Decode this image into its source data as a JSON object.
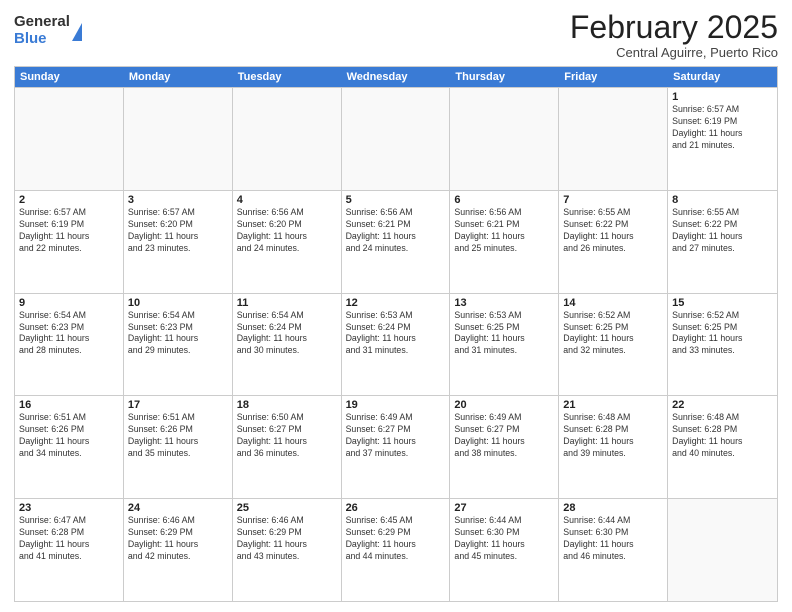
{
  "logo": {
    "general": "General",
    "blue": "Blue"
  },
  "title": "February 2025",
  "location": "Central Aguirre, Puerto Rico",
  "header_days": [
    "Sunday",
    "Monday",
    "Tuesday",
    "Wednesday",
    "Thursday",
    "Friday",
    "Saturday"
  ],
  "rows": [
    [
      {
        "day": "",
        "info": ""
      },
      {
        "day": "",
        "info": ""
      },
      {
        "day": "",
        "info": ""
      },
      {
        "day": "",
        "info": ""
      },
      {
        "day": "",
        "info": ""
      },
      {
        "day": "",
        "info": ""
      },
      {
        "day": "1",
        "info": "Sunrise: 6:57 AM\nSunset: 6:19 PM\nDaylight: 11 hours\nand 21 minutes."
      }
    ],
    [
      {
        "day": "2",
        "info": "Sunrise: 6:57 AM\nSunset: 6:19 PM\nDaylight: 11 hours\nand 22 minutes."
      },
      {
        "day": "3",
        "info": "Sunrise: 6:57 AM\nSunset: 6:20 PM\nDaylight: 11 hours\nand 23 minutes."
      },
      {
        "day": "4",
        "info": "Sunrise: 6:56 AM\nSunset: 6:20 PM\nDaylight: 11 hours\nand 24 minutes."
      },
      {
        "day": "5",
        "info": "Sunrise: 6:56 AM\nSunset: 6:21 PM\nDaylight: 11 hours\nand 24 minutes."
      },
      {
        "day": "6",
        "info": "Sunrise: 6:56 AM\nSunset: 6:21 PM\nDaylight: 11 hours\nand 25 minutes."
      },
      {
        "day": "7",
        "info": "Sunrise: 6:55 AM\nSunset: 6:22 PM\nDaylight: 11 hours\nand 26 minutes."
      },
      {
        "day": "8",
        "info": "Sunrise: 6:55 AM\nSunset: 6:22 PM\nDaylight: 11 hours\nand 27 minutes."
      }
    ],
    [
      {
        "day": "9",
        "info": "Sunrise: 6:54 AM\nSunset: 6:23 PM\nDaylight: 11 hours\nand 28 minutes."
      },
      {
        "day": "10",
        "info": "Sunrise: 6:54 AM\nSunset: 6:23 PM\nDaylight: 11 hours\nand 29 minutes."
      },
      {
        "day": "11",
        "info": "Sunrise: 6:54 AM\nSunset: 6:24 PM\nDaylight: 11 hours\nand 30 minutes."
      },
      {
        "day": "12",
        "info": "Sunrise: 6:53 AM\nSunset: 6:24 PM\nDaylight: 11 hours\nand 31 minutes."
      },
      {
        "day": "13",
        "info": "Sunrise: 6:53 AM\nSunset: 6:25 PM\nDaylight: 11 hours\nand 31 minutes."
      },
      {
        "day": "14",
        "info": "Sunrise: 6:52 AM\nSunset: 6:25 PM\nDaylight: 11 hours\nand 32 minutes."
      },
      {
        "day": "15",
        "info": "Sunrise: 6:52 AM\nSunset: 6:25 PM\nDaylight: 11 hours\nand 33 minutes."
      }
    ],
    [
      {
        "day": "16",
        "info": "Sunrise: 6:51 AM\nSunset: 6:26 PM\nDaylight: 11 hours\nand 34 minutes."
      },
      {
        "day": "17",
        "info": "Sunrise: 6:51 AM\nSunset: 6:26 PM\nDaylight: 11 hours\nand 35 minutes."
      },
      {
        "day": "18",
        "info": "Sunrise: 6:50 AM\nSunset: 6:27 PM\nDaylight: 11 hours\nand 36 minutes."
      },
      {
        "day": "19",
        "info": "Sunrise: 6:49 AM\nSunset: 6:27 PM\nDaylight: 11 hours\nand 37 minutes."
      },
      {
        "day": "20",
        "info": "Sunrise: 6:49 AM\nSunset: 6:27 PM\nDaylight: 11 hours\nand 38 minutes."
      },
      {
        "day": "21",
        "info": "Sunrise: 6:48 AM\nSunset: 6:28 PM\nDaylight: 11 hours\nand 39 minutes."
      },
      {
        "day": "22",
        "info": "Sunrise: 6:48 AM\nSunset: 6:28 PM\nDaylight: 11 hours\nand 40 minutes."
      }
    ],
    [
      {
        "day": "23",
        "info": "Sunrise: 6:47 AM\nSunset: 6:28 PM\nDaylight: 11 hours\nand 41 minutes."
      },
      {
        "day": "24",
        "info": "Sunrise: 6:46 AM\nSunset: 6:29 PM\nDaylight: 11 hours\nand 42 minutes."
      },
      {
        "day": "25",
        "info": "Sunrise: 6:46 AM\nSunset: 6:29 PM\nDaylight: 11 hours\nand 43 minutes."
      },
      {
        "day": "26",
        "info": "Sunrise: 6:45 AM\nSunset: 6:29 PM\nDaylight: 11 hours\nand 44 minutes."
      },
      {
        "day": "27",
        "info": "Sunrise: 6:44 AM\nSunset: 6:30 PM\nDaylight: 11 hours\nand 45 minutes."
      },
      {
        "day": "28",
        "info": "Sunrise: 6:44 AM\nSunset: 6:30 PM\nDaylight: 11 hours\nand 46 minutes."
      },
      {
        "day": "",
        "info": ""
      }
    ]
  ]
}
